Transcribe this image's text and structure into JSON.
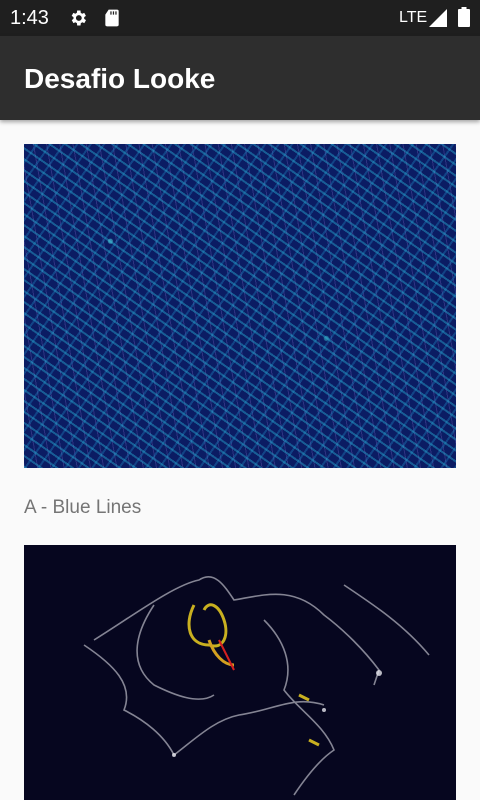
{
  "status_bar": {
    "time": "1:43",
    "network": "LTE",
    "icons": [
      "gear-icon",
      "sd-card-icon",
      "signal-icon",
      "battery-icon"
    ]
  },
  "app_bar": {
    "title": "Desafio Looke"
  },
  "items": [
    {
      "caption": "A - Blue Lines"
    }
  ],
  "colors": {
    "status_bar": "#1f1f1f",
    "app_bar": "#2e2e2e",
    "background": "#fafafa",
    "caption": "#757575"
  }
}
